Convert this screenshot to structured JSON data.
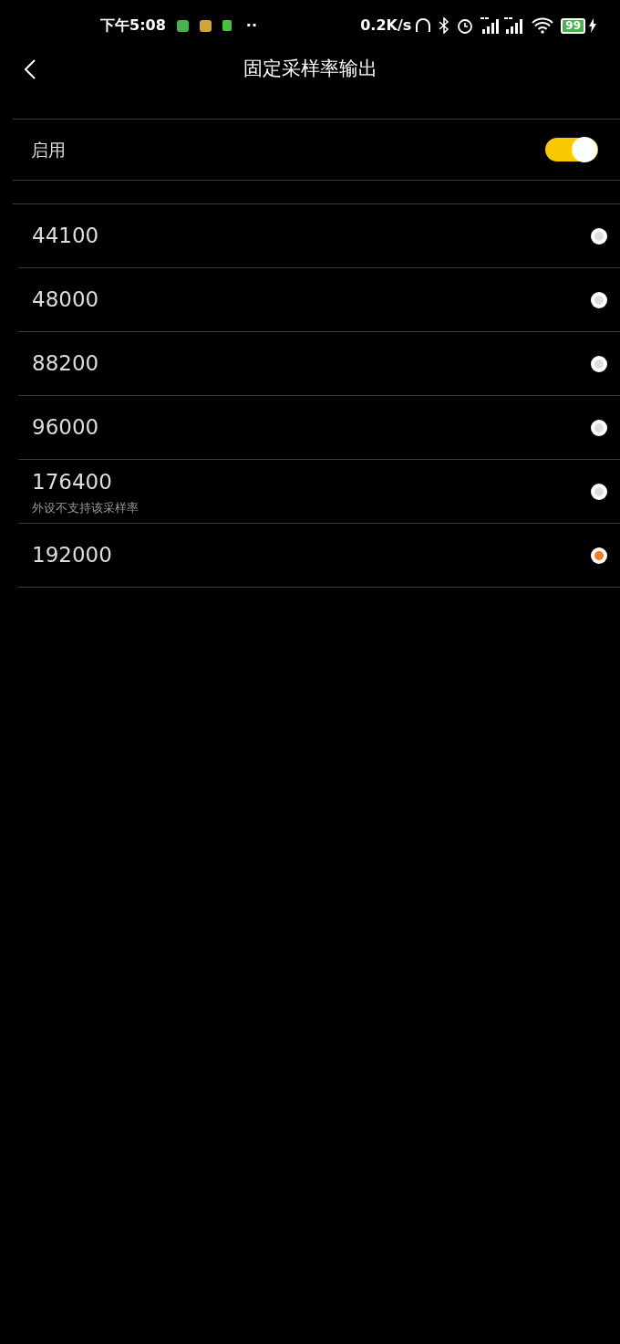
{
  "status_bar": {
    "time": "下午5:08",
    "more": "··",
    "speed": "0.2K/s",
    "battery": "99"
  },
  "header": {
    "title": "固定采样率输出"
  },
  "enable": {
    "label": "启用",
    "on": true
  },
  "rates": [
    {
      "label": "44100",
      "selected": false
    },
    {
      "label": "48000",
      "selected": false
    },
    {
      "label": "88200",
      "selected": false
    },
    {
      "label": "96000",
      "selected": false
    },
    {
      "label": "176400",
      "note": "外设不支持该采样率",
      "selected": false
    },
    {
      "label": "192000",
      "selected": true
    }
  ]
}
